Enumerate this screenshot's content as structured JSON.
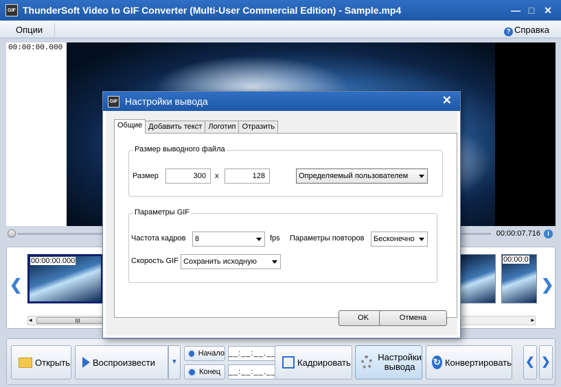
{
  "window": {
    "title": "ThunderSoft Video to GIF Converter (Multi-User Commercial Edition) - Sample.mp4",
    "icon_text": "GIF",
    "controls": [
      "—",
      "□",
      "✕"
    ]
  },
  "menu": {
    "options": "Опции",
    "help": "Справка",
    "help_icon": "?"
  },
  "player": {
    "current_time": "00:00:00.000",
    "total_time": "00:00:07.716",
    "info_icon": "i"
  },
  "thumbnails": {
    "items": [
      {
        "time": "00:00:00.000"
      },
      {
        "time": "00:00:0"
      }
    ],
    "scroll_left": "◂",
    "scroll_right": "▸",
    "scroll_grip": "III",
    "prev_arrow": "❮",
    "next_arrow": "❯"
  },
  "toolbar": {
    "open": "Открыть",
    "play": "Воспроизвести",
    "play_dropdown": "▼",
    "start": "Начало",
    "end": "Конец",
    "start_time": "__:__:__.___",
    "end_time": "__:__:__.___",
    "crop": "Кадрировать",
    "output_settings_line1": "Настройки",
    "output_settings_line2": "вывода",
    "convert": "Конвертировать",
    "convert_icon": "↻",
    "prev": "❮",
    "next": "❯"
  },
  "dialog": {
    "title": "Настройки вывода",
    "icon_text": "GIF",
    "close": "✕",
    "tabs": [
      "Общие",
      "Добавить текст",
      "Логотип",
      "Отразить"
    ],
    "size_group": {
      "label": "Размер выводного файла",
      "size_label": "Размер",
      "width": "300",
      "separator": "x",
      "height": "128",
      "preset": "Определяемый пользователем"
    },
    "gif_group": {
      "label": "Параметры GIF",
      "frame_rate_label": "Частота кадров",
      "frame_rate": "8",
      "fps_unit": "fps",
      "repeat_label": "Параметры повторов",
      "repeat": "Бесконечно",
      "speed_label": "Скорость GIF",
      "speed": "Сохранить исходную"
    },
    "ok": "OK",
    "cancel": "Отмена"
  },
  "colors": {
    "titlebar": "#2f6fc4",
    "accent": "#2e6fcc"
  }
}
